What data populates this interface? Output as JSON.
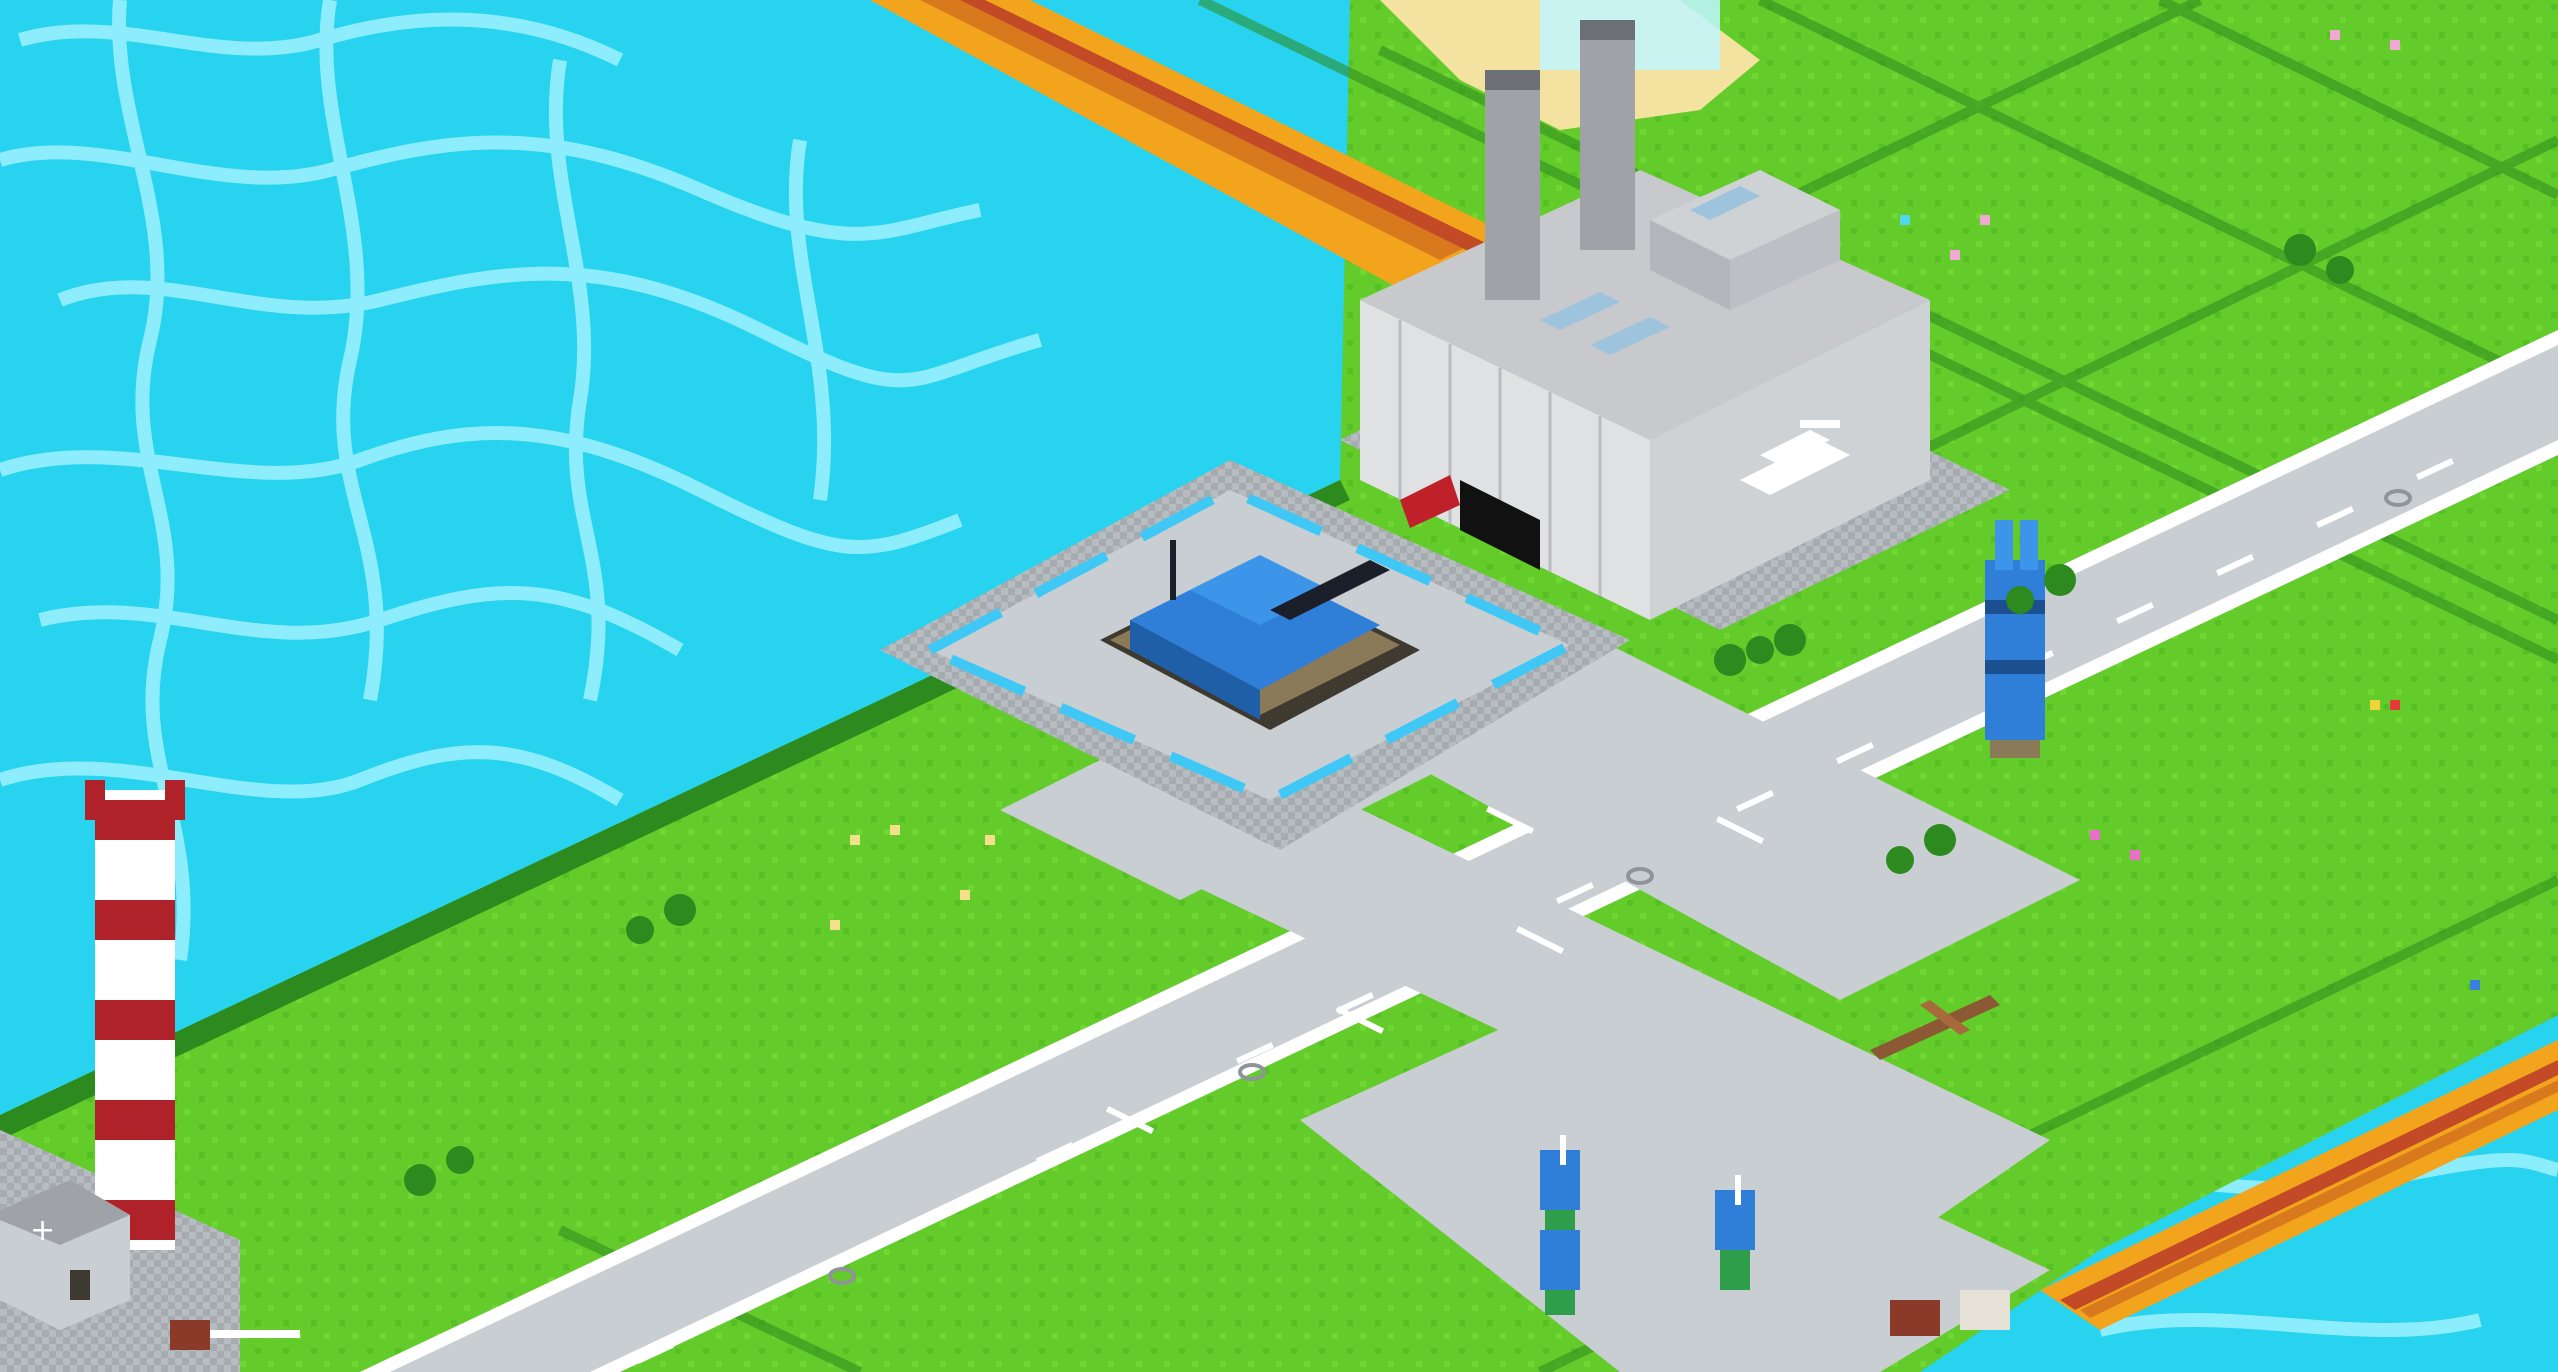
{
  "scene": {
    "view": "isometric-voxel-map",
    "colors": {
      "water": "#27d3ee",
      "water_foam": "#9ff2ff",
      "grass": "#63cc2a",
      "grass_dark": "#2d8a1e",
      "road": "#c9ced3",
      "road_marking": "#ffffff",
      "tile_pad": "#a9aeb3",
      "factory_wall": "#dfe1e3",
      "factory_roof": "#c7c9cc",
      "player_blue": "#2f7fd9",
      "tower_red": "#b0222a",
      "bridge_orange": "#f2a51c"
    },
    "entities": {
      "factory_icon": "tank-icon",
      "tank_icon": "tank-icon",
      "mech_icon": "mech-icon",
      "infantry_icon": "infantry-icon",
      "tower_icon": "radio-tower-icon",
      "hospital_icon": "medical-cross-icon",
      "barrier_icon": "barrier-gate-icon"
    }
  }
}
